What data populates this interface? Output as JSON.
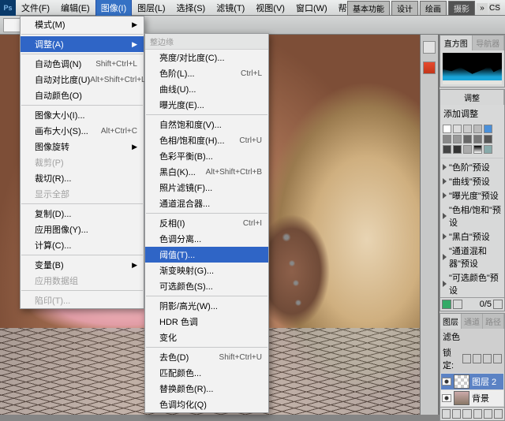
{
  "menubar": {
    "items": [
      "文件(F)",
      "编辑(E)",
      "图像(I)",
      "图层(L)",
      "选择(S)",
      "滤镜(T)",
      "视图(V)",
      "窗口(W)",
      "帮助(H)"
    ],
    "active_index": 2
  },
  "top_tabs": [
    "基本功能",
    "设计",
    "绘画",
    "摄影"
  ],
  "top_tabs_active": 3,
  "cs_label": "CS",
  "menu1": {
    "groups": [
      [
        {
          "label": "模式(M)",
          "arrow": true
        }
      ],
      [
        {
          "label": "调整(A)",
          "arrow": true,
          "hl": true
        }
      ],
      [
        {
          "label": "自动色调(N)",
          "short": "Shift+Ctrl+L"
        },
        {
          "label": "自动对比度(U)",
          "short": "Alt+Shift+Ctrl+L"
        },
        {
          "label": "自动颜色(O)",
          "short": ""
        }
      ],
      [
        {
          "label": "图像大小(I)...",
          "short": ""
        },
        {
          "label": "画布大小(S)...",
          "short": "Alt+Ctrl+C"
        },
        {
          "label": "图像旋转",
          "arrow": true
        },
        {
          "label": "裁剪(P)",
          "disabled": true
        },
        {
          "label": "裁切(R)...",
          "short": ""
        },
        {
          "label": "显示全部",
          "disabled": true
        }
      ],
      [
        {
          "label": "复制(D)...",
          "short": ""
        },
        {
          "label": "应用图像(Y)...",
          "short": ""
        },
        {
          "label": "计算(C)...",
          "short": ""
        }
      ],
      [
        {
          "label": "变量(B)",
          "arrow": true
        },
        {
          "label": "应用数据组",
          "disabled": true
        }
      ],
      [
        {
          "label": "陷印(T)...",
          "disabled": true
        }
      ]
    ]
  },
  "menu2": {
    "header": "整边缘",
    "groups": [
      [
        {
          "label": "亮度/对比度(C)..."
        },
        {
          "label": "色阶(L)...",
          "short": "Ctrl+L"
        },
        {
          "label": "曲线(U)..."
        },
        {
          "label": "曝光度(E)..."
        }
      ],
      [
        {
          "label": "自然饱和度(V)..."
        },
        {
          "label": "色相/饱和度(H)...",
          "short": "Ctrl+U"
        },
        {
          "label": "色彩平衡(B)..."
        },
        {
          "label": "黑白(K)...",
          "short": "Alt+Shift+Ctrl+B"
        },
        {
          "label": "照片滤镜(F)..."
        },
        {
          "label": "通道混合器..."
        }
      ],
      [
        {
          "label": "反相(I)",
          "short": "Ctrl+I"
        },
        {
          "label": "色调分离..."
        },
        {
          "label": "阈值(T)...",
          "hl": true
        },
        {
          "label": "渐变映射(G)..."
        },
        {
          "label": "可选颜色(S)..."
        }
      ],
      [
        {
          "label": "阴影/高光(W)..."
        },
        {
          "label": "HDR 色调"
        },
        {
          "label": "变化"
        }
      ],
      [
        {
          "label": "去色(D)",
          "short": "Shift+Ctrl+U"
        },
        {
          "label": "匹配颜色..."
        },
        {
          "label": "替换颜色(R)..."
        },
        {
          "label": "色调均化(Q)"
        }
      ]
    ]
  },
  "panels": {
    "histogram_tabs": [
      "直方图",
      "导航器"
    ],
    "adjustments_tab": "调整",
    "add_adjustment": "添加调整",
    "presets": [
      "\"色阶\"预设",
      "\"曲线\"预设",
      "\"曝光度\"预设",
      "\"色相/饱和\"预设",
      "\"黑白\"预设",
      "\"通道混和器\"预设",
      "\"可选颜色\"预设"
    ],
    "layers_tabs": [
      "图层",
      "通道",
      "路径"
    ],
    "blend_mode": "滤色",
    "lock_label": "锁定:",
    "layers": [
      {
        "name": "图层 2"
      },
      {
        "name": "背景"
      }
    ],
    "fill_value": "0/5"
  }
}
